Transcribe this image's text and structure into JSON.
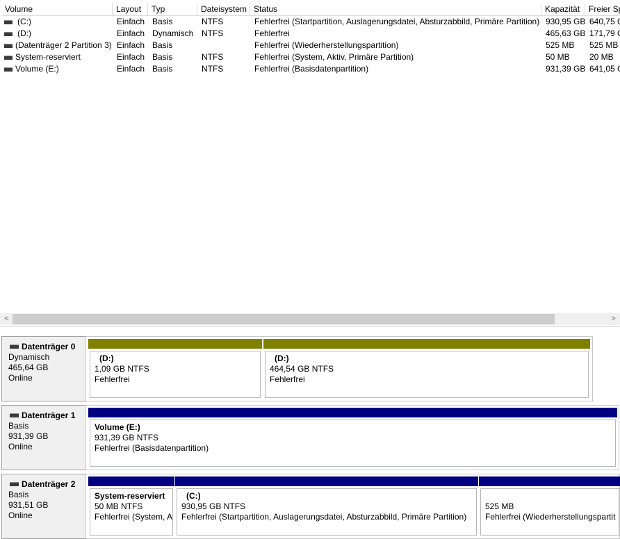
{
  "columns": [
    "Volume",
    "Layout",
    "Typ",
    "Dateisystem",
    "Status",
    "Kapazität",
    "Freier Sp"
  ],
  "volumes": [
    {
      "volume": "(C:)",
      "layout": "Einfach",
      "typ": "Basis",
      "fs": "NTFS",
      "status": "Fehlerfrei (Startpartition, Auslagerungsdatei, Absturzabbild, Primäre Partition)",
      "kapazitaet": "930,95 GB",
      "frei": "640,75 G"
    },
    {
      "volume": "(D:)",
      "layout": "Einfach",
      "typ": "Dynamisch",
      "fs": "NTFS",
      "status": "Fehlerfrei",
      "kapazitaet": "465,63 GB",
      "frei": "171,79 G"
    },
    {
      "volume": "(Datenträger 2 Partition 3)",
      "layout": "Einfach",
      "typ": "Basis",
      "fs": "",
      "status": "Fehlerfrei (Wiederherstellungspartition)",
      "kapazitaet": "525 MB",
      "frei": "525 MB"
    },
    {
      "volume": "System-reserviert",
      "layout": "Einfach",
      "typ": "Basis",
      "fs": "NTFS",
      "status": "Fehlerfrei (System, Aktiv, Primäre Partition)",
      "kapazitaet": "50 MB",
      "frei": "20 MB"
    },
    {
      "volume": "Volume (E:)",
      "layout": "Einfach",
      "typ": "Basis",
      "fs": "NTFS",
      "status": "Fehlerfrei (Basisdatenpartition)",
      "kapazitaet": "931,39 GB",
      "frei": "641,05 G"
    }
  ],
  "scroll": {
    "left_arrow": "<",
    "right_arrow": ">"
  },
  "disks": [
    {
      "name": "Datenträger 0",
      "type": "Dynamisch",
      "size": "465,64 GB",
      "state": "Online",
      "partitions": [
        {
          "name": "(D:)",
          "size": "1,09 GB NTFS",
          "status": "Fehlerfrei",
          "color": "#808000"
        },
        {
          "name": "(D:)",
          "size": "464,54 GB NTFS",
          "status": "Fehlerfrei",
          "color": "#808000"
        }
      ]
    },
    {
      "name": "Datenträger 1",
      "type": "Basis",
      "size": "931,39 GB",
      "state": "Online",
      "partitions": [
        {
          "name": "Volume  (E:)",
          "size": "931,39 GB NTFS",
          "status": "Fehlerfrei (Basisdatenpartition)",
          "color": "#000080"
        }
      ]
    },
    {
      "name": "Datenträger 2",
      "type": "Basis",
      "size": "931,51 GB",
      "state": "Online",
      "partitions": [
        {
          "name": "System-reserviert",
          "size": "50 MB NTFS",
          "status": "Fehlerfrei (System, A",
          "color": "#000080"
        },
        {
          "name": "(C:)",
          "size": "930,95 GB NTFS",
          "status": "Fehlerfrei (Startpartition, Auslagerungsdatei, Absturzabbild, Primäre Partition)",
          "color": "#000080"
        },
        {
          "name": "",
          "size": "525 MB",
          "status": "Fehlerfrei (Wiederherstellungspartit",
          "color": "#000080"
        }
      ]
    }
  ]
}
